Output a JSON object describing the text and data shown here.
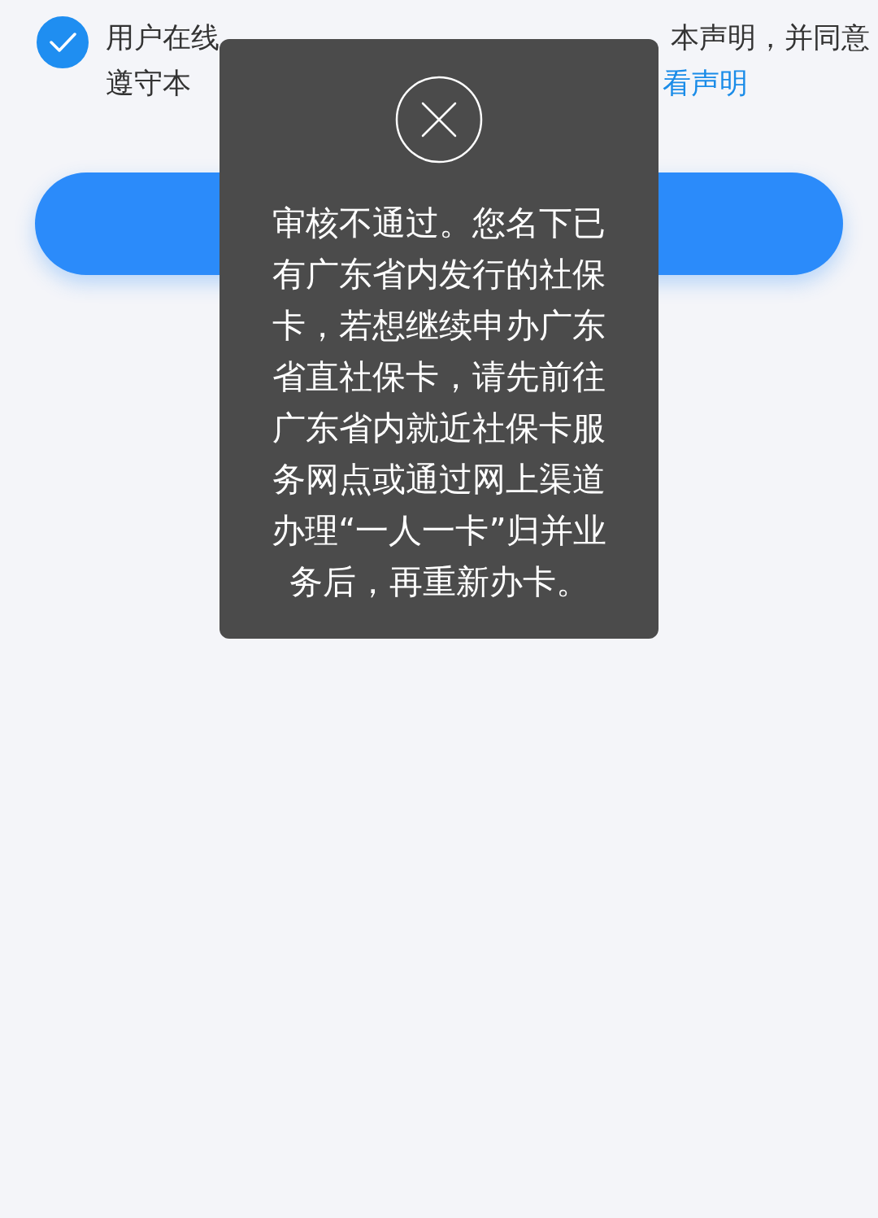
{
  "agreement": {
    "checked": true,
    "line_1_left": "用户在线",
    "line_1_right": "本声明，并同意",
    "line_2_left": "遵守本",
    "link": "看声明"
  },
  "toast": {
    "message": "审核不通过。您名下已有广东省内发行的社保卡，若想继续申办广东省直社保卡，请先前往广东省内就近社保卡服务网点或通过网上渠道办理“一人一卡”归并业务后，再重新办卡。"
  }
}
